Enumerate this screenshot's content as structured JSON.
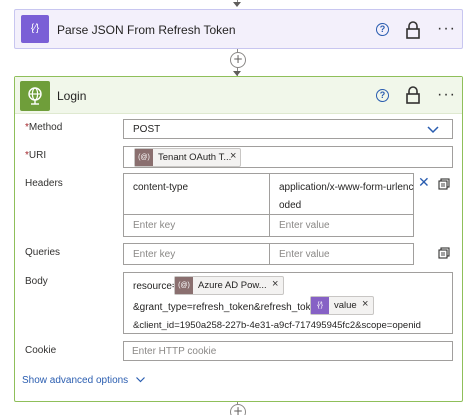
{
  "top_connector": {
    "icon": "arrow-down-icon"
  },
  "parse_action": {
    "title": "Parse JSON From Refresh Token",
    "icon": "curly-braces-icon",
    "icon_glyph": "{⁄}",
    "accent": "#7a5fd6"
  },
  "connector_add": {
    "icon": "plus-icon",
    "glyph": "+"
  },
  "login_action": {
    "title": "Login",
    "icon": "globe-icon",
    "accent": "#6f9e3a",
    "method": {
      "label": "Method",
      "required_marker": "*",
      "value": "POST"
    },
    "uri": {
      "label": "URI",
      "required_marker": "*",
      "token_label": "Tenant OAuth T...",
      "token_icon": "parameter-icon"
    },
    "headers": {
      "label": "Headers",
      "rows": [
        {
          "key": "content-type",
          "value_line1": "application/x-www-form-urlenc",
          "value_line2": "oded"
        }
      ],
      "key_placeholder": "Enter key",
      "value_placeholder": "Enter value"
    },
    "queries": {
      "label": "Queries",
      "key_placeholder": "Enter key",
      "value_placeholder": "Enter value"
    },
    "body": {
      "label": "Body",
      "prefix": "resource=",
      "token1_label": "Azure AD Pow...",
      "line2_text": "&grant_type=refresh_token&refresh_token=",
      "token2_label": "value",
      "token2_glyph": "{⁄}",
      "line3_text": "&client_id=1950a258-227b-4e31-a9cf-717495945fc2&scope=openid"
    },
    "cookie": {
      "label": "Cookie",
      "placeholder": "Enter HTTP cookie"
    },
    "advanced_link": "Show advanced options"
  },
  "colors": {
    "link_blue": "#2a5db0",
    "required_red": "#a4262c",
    "parameter_token": "#8a6f6f",
    "expression_token": "#8661c5"
  }
}
